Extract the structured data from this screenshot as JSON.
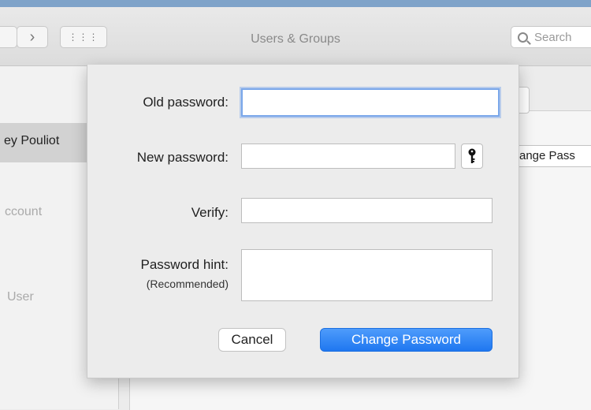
{
  "window": {
    "title": "Users & Groups"
  },
  "toolbar": {
    "back_label": "‹",
    "forward_label": "›",
    "grid_label": "⋮⋮⋮",
    "search_placeholder": "Search"
  },
  "sidebar": {
    "selected_user": "ey Pouliot",
    "items": [
      {
        "label": "ccount"
      },
      {
        "label": "User"
      }
    ]
  },
  "background": {
    "change_password_button": "ange Pass"
  },
  "dialog": {
    "old_password_label": "Old password:",
    "old_password_value": "",
    "new_password_label": "New password:",
    "new_password_value": "",
    "verify_label": "Verify:",
    "verify_value": "",
    "hint_label": "Password hint:",
    "hint_sublabel": "(Recommended)",
    "hint_value": "",
    "cancel_label": "Cancel",
    "submit_label": "Change Password",
    "key_icon": "key-icon"
  },
  "colors": {
    "accent": "#2b82f6",
    "focus_ring": "#7aa7ea",
    "title_bar_strip": "#7fa3c9"
  }
}
